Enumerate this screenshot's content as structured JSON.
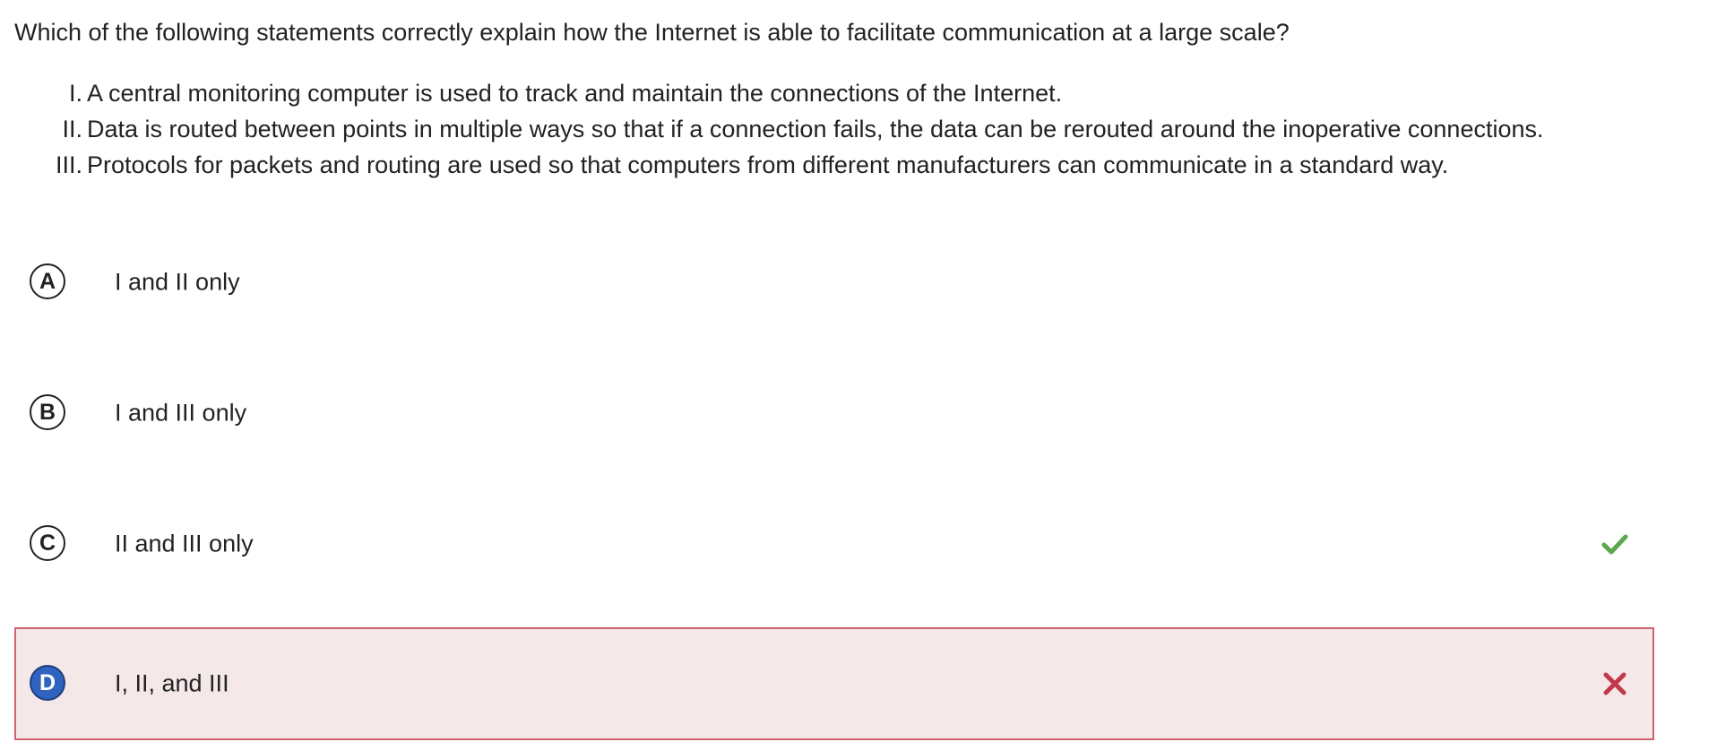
{
  "question": "Which of the following statements correctly explain how the Internet is able to facilitate communication at a large scale?",
  "statements": [
    {
      "num": "I.",
      "text": "A central monitoring computer is used to track and maintain the connections of the Internet."
    },
    {
      "num": "II.",
      "text": "Data is routed between points in multiple ways so that if a connection fails, the data can be rerouted around the inoperative connections."
    },
    {
      "num": "III.",
      "text": "Protocols for packets and routing are used so that computers from different manufacturers can communicate in a standard way."
    }
  ],
  "options": [
    {
      "letter": "A",
      "label": "I and II only",
      "state": "none"
    },
    {
      "letter": "B",
      "label": "I and III only",
      "state": "none"
    },
    {
      "letter": "C",
      "label": "II and III only",
      "state": "correct",
      "mark_icon": "check-icon"
    },
    {
      "letter": "D",
      "label": "I, II, and III",
      "state": "selected-wrong",
      "mark_icon": "cross-icon"
    }
  ],
  "colors": {
    "correct": "#5ba84f",
    "wrong": "#c0394a",
    "selected_bg": "#f4e8e9",
    "selected_border": "#d0616f",
    "selected_letter_bg": "#2f63bf"
  }
}
